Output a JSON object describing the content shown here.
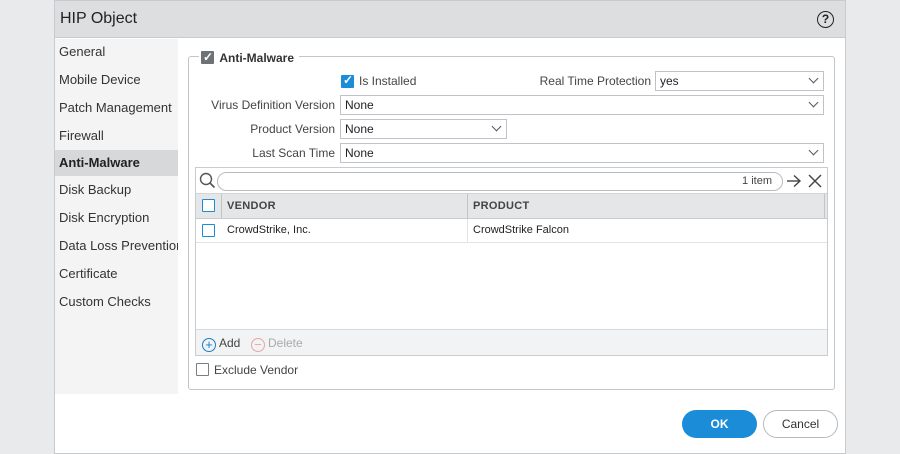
{
  "dialog": {
    "title": "HIP Object",
    "help_glyph": "?"
  },
  "sidebar": {
    "items": [
      {
        "label": "General",
        "active": false
      },
      {
        "label": "Mobile Device",
        "active": false
      },
      {
        "label": "Patch Management",
        "active": false
      },
      {
        "label": "Firewall",
        "active": false
      },
      {
        "label": "Anti-Malware",
        "active": true
      },
      {
        "label": "Disk Backup",
        "active": false
      },
      {
        "label": "Disk Encryption",
        "active": false
      },
      {
        "label": "Data Loss Prevention",
        "active": false
      },
      {
        "label": "Certificate",
        "active": false
      },
      {
        "label": "Custom Checks",
        "active": false
      }
    ]
  },
  "section": {
    "legend_label": "Anti-Malware",
    "enabled": true
  },
  "form": {
    "is_installed_label": "Is Installed",
    "is_installed": true,
    "real_time_protection_label": "Real Time Protection",
    "real_time_protection_value": "yes",
    "virus_def_label": "Virus Definition Version",
    "virus_def_value": "None",
    "product_version_label": "Product Version",
    "product_version_value": "None",
    "last_scan_label": "Last Scan Time",
    "last_scan_value": "None"
  },
  "grid": {
    "item_count": "1 item",
    "columns": [
      "VENDOR",
      "PRODUCT"
    ],
    "rows": [
      {
        "vendor": "CrowdStrike, Inc.",
        "product": "CrowdStrike Falcon"
      }
    ],
    "add_label": "Add",
    "delete_label": "Delete"
  },
  "exclude_vendor_label": "Exclude Vendor",
  "buttons": {
    "ok": "OK",
    "cancel": "Cancel"
  },
  "colors": {
    "accent": "#1a8cd8",
    "title_bar": "#dcdedf",
    "sidebar_active": "#d6d8da"
  }
}
